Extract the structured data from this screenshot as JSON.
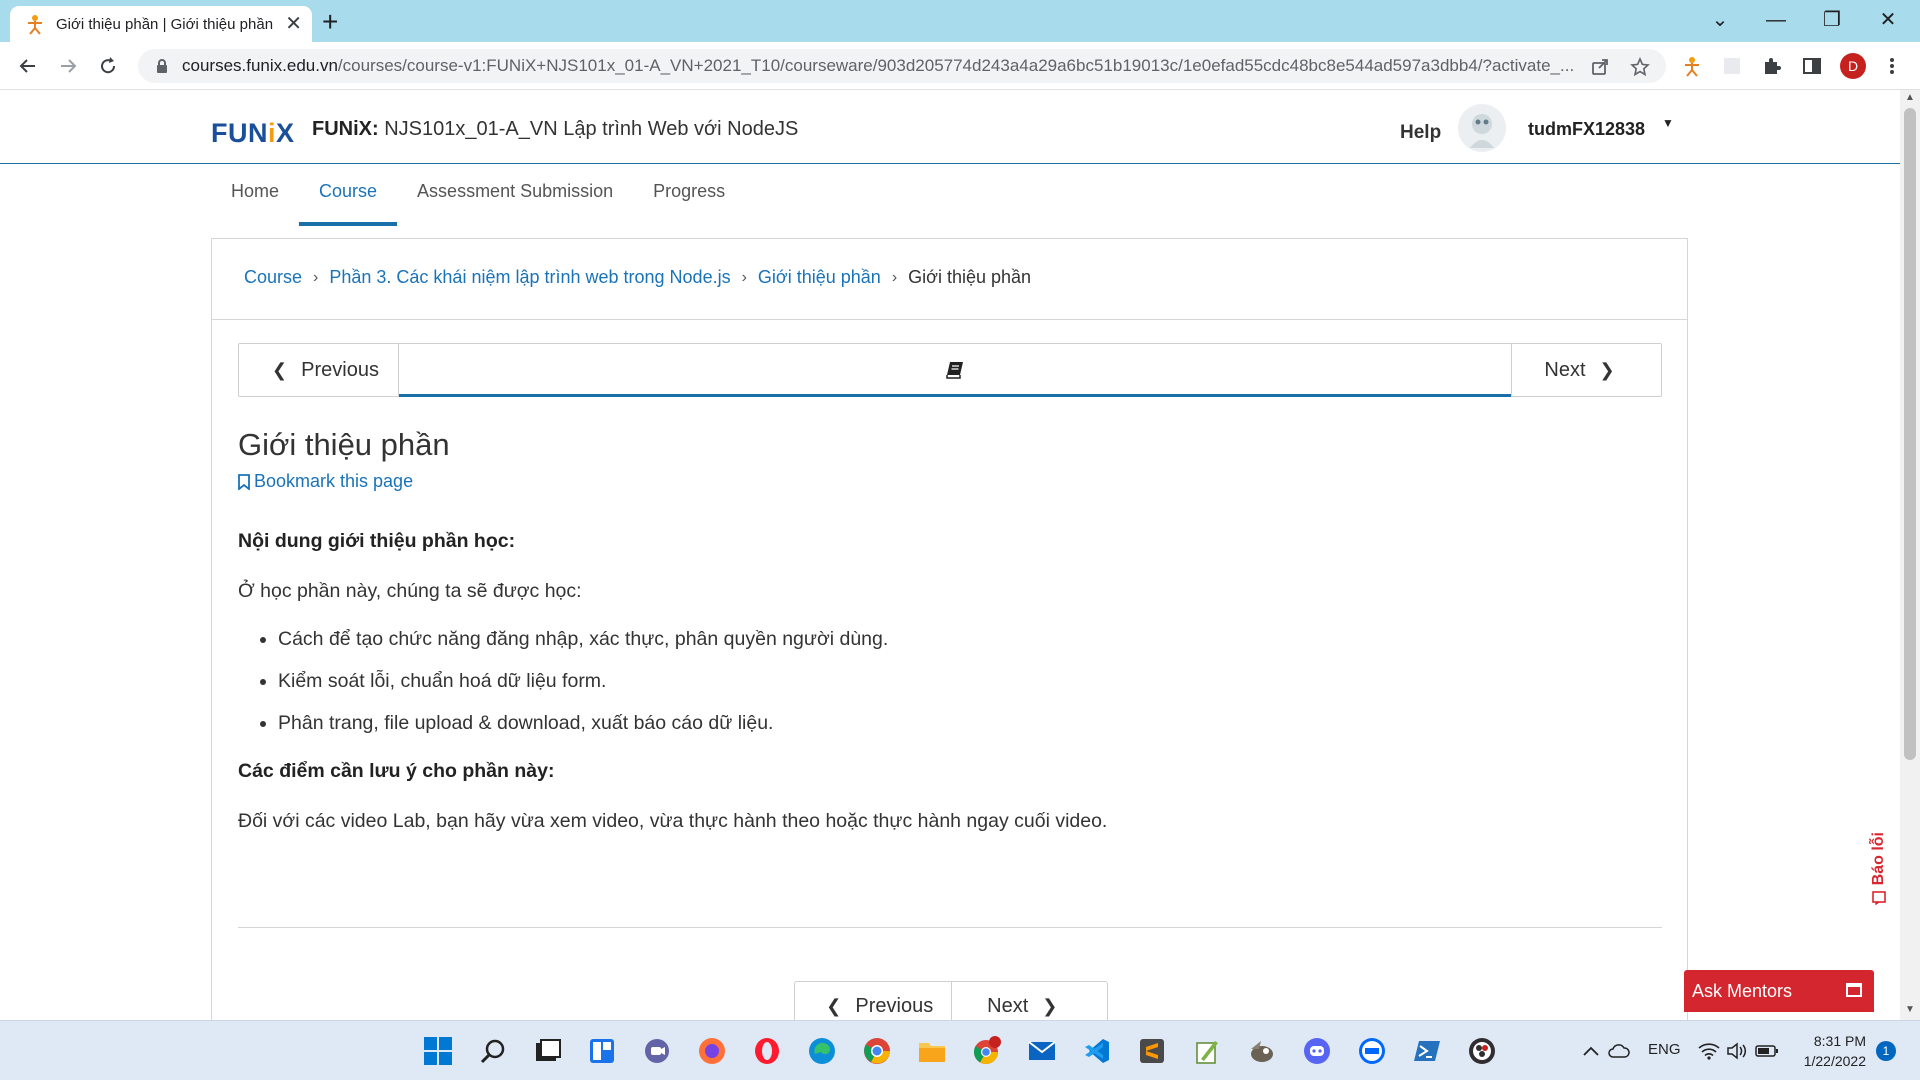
{
  "browser": {
    "tab_title": "Giới thiệu phần | Giới thiệu phần",
    "tab_close": "✕",
    "new_tab": "+",
    "url_host": "courses.funix.edu.vn",
    "url_path": "/courses/course-v1:FUNiX+NJS101x_01-A_VN+2021_T10/courseware/903d205774d243a4a29a6bc51b19013c/1e0efad55cdc48bc8e544ad597a3dbb4/?activate_...",
    "profile_initial": "D"
  },
  "header": {
    "logo_text_a": "FUN",
    "logo_text_b": "i",
    "logo_text_c": "X",
    "course_org": "FUNiX:",
    "course_name": "NJS101x_01-A_VN Lập trình Web với NodeJS",
    "help": "Help",
    "username": "tudmFX12838"
  },
  "course_nav": {
    "tabs": [
      "Home",
      "Course",
      "Assessment Submission",
      "Progress"
    ],
    "active_index": 1
  },
  "breadcrumb": {
    "items": [
      "Course",
      "Phần 3. Các khái niệm lập trình web trong Node.js",
      "Giới thiệu phần"
    ],
    "current": "Giới thiệu phần"
  },
  "sequence": {
    "previous": "Previous",
    "next": "Next"
  },
  "unit": {
    "title": "Giới thiệu phần",
    "bookmark": "Bookmark this page",
    "heading1": "Nội dung giới thiệu phần học:",
    "intro": "Ở học phần này, chúng ta sẽ được học:",
    "bullets": [
      "Cách để tạo chức năng đăng nhập, xác thực, phân quyền người dùng.",
      "Kiểm soát lỗi, chuẩn hoá dữ liệu form.",
      "Phân trang, file upload & download, xuất báo cáo dữ liệu."
    ],
    "heading2": "Các điểm cần lưu ý cho phần này:",
    "note": "Đối với các video Lab, bạn hãy vừa xem video, vừa thực hành theo hoặc thực hành ngay cuối video."
  },
  "bottom_nav": {
    "previous": "Previous",
    "next": "Next"
  },
  "widgets": {
    "report": "Báo lỗi",
    "ask_mentors": "Ask Mentors"
  },
  "taskbar": {
    "lang": "ENG",
    "time": "8:31 PM",
    "date": "1/22/2022",
    "notifications": "1"
  },
  "colors": {
    "accent": "#1a73b8",
    "brand": "#1a4f9c",
    "alert": "#d3262f"
  }
}
